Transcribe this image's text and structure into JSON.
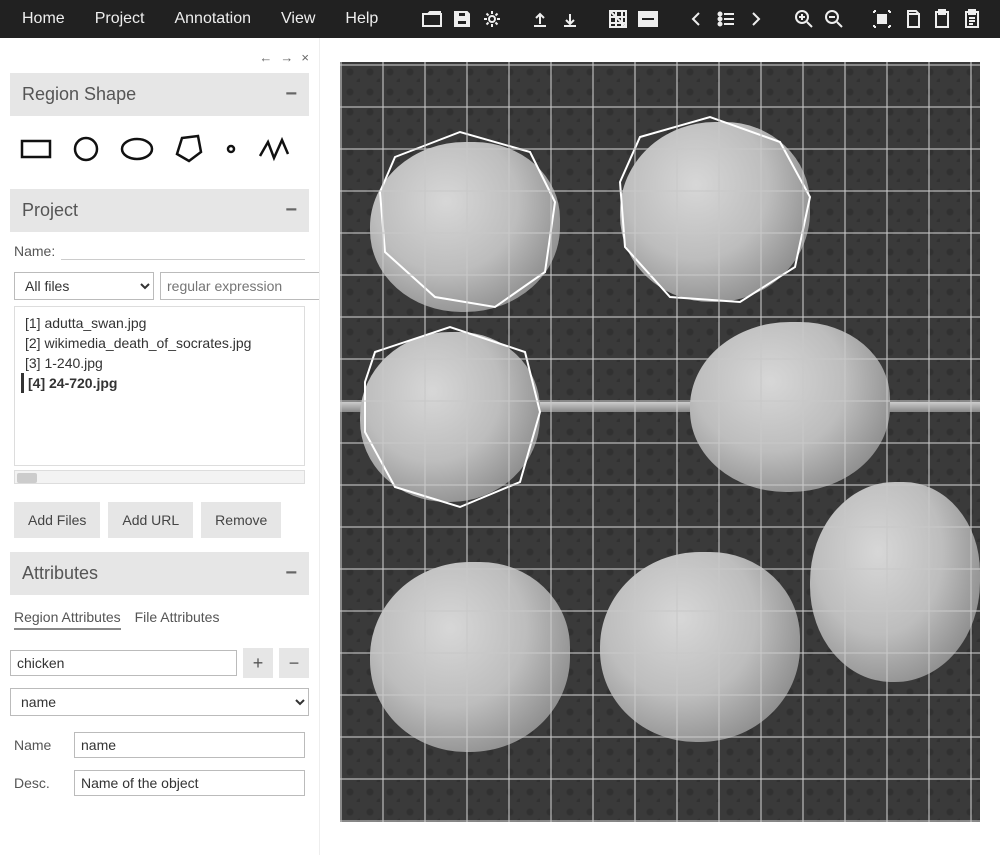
{
  "menu": {
    "items": [
      "Home",
      "Project",
      "Annotation",
      "View",
      "Help"
    ]
  },
  "sidebar": {
    "region_shape": {
      "title": "Region Shape"
    },
    "project": {
      "title": "Project",
      "name_label": "Name:",
      "filter_options": [
        "All files"
      ],
      "filter_selected": "All files",
      "regex_placeholder": "regular expression",
      "files": [
        "[1] adutta_swan.jpg",
        "[2] wikimedia_death_of_socrates.jpg",
        "[3] 1-240.jpg",
        "[4] 24-720.jpg"
      ],
      "selected_index": 3,
      "add_files": "Add Files",
      "add_url": "Add URL",
      "remove": "Remove"
    },
    "attributes": {
      "title": "Attributes",
      "tab_region": "Region Attributes",
      "tab_file": "File Attributes",
      "attr_name_value": "chicken",
      "select_value": "name",
      "row_name_label": "Name",
      "row_name_value": "name",
      "row_desc_label": "Desc.",
      "row_desc_value": "Name of the object"
    }
  }
}
